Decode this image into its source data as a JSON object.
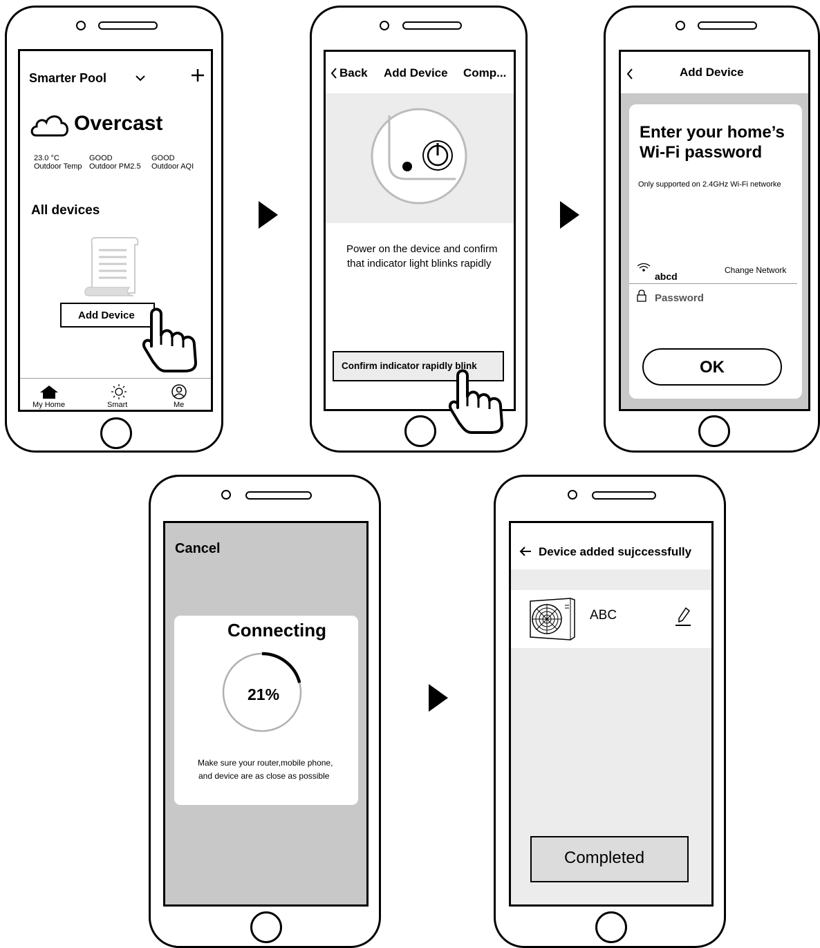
{
  "screen1": {
    "home_name": "Smarter Pool",
    "weather": "Overcast",
    "stats": [
      {
        "value": "23.0 °C",
        "label": "Outdoor Temp"
      },
      {
        "value": "GOOD",
        "label": "Outdoor PM2.5"
      },
      {
        "value": "GOOD",
        "label": "Outdoor AQI"
      }
    ],
    "section_title": "All devices",
    "add_device_button": "Add Device",
    "tabs": [
      "My Home",
      "Smart",
      "Me"
    ]
  },
  "screen2": {
    "back_label": "Back",
    "title": "Add Device",
    "right_label": "Comp...",
    "instruction_line1": "Power on the device and confirm",
    "instruction_line2": "that indicator light blinks rapidly",
    "confirm_button": "Confirm indicator rapidly blink"
  },
  "screen3": {
    "title": "Add Device",
    "heading_line1": "Enter your home’s",
    "heading_line2": "Wi-Fi password",
    "note": "Only supported on 2.4GHz Wi-Fi networke",
    "network_name": "abcd",
    "change_network": "Change Network",
    "password_placeholder": "Password",
    "ok_button": "OK"
  },
  "screen4": {
    "cancel_label": "Cancel",
    "title": "Connecting",
    "progress": 21,
    "progress_label": "21%",
    "hint_line1": "Make sure your router,mobile phone,",
    "hint_line2": "and device are as close as possible"
  },
  "screen5": {
    "title": "Device added sujccessfully",
    "device_name": "ABC",
    "completed_button": "Completed"
  },
  "colors": {
    "line": "#000000",
    "gray_panel": "#c8c8c8",
    "light_gray": "#ececec",
    "progress_track": "#b0b0b0"
  }
}
